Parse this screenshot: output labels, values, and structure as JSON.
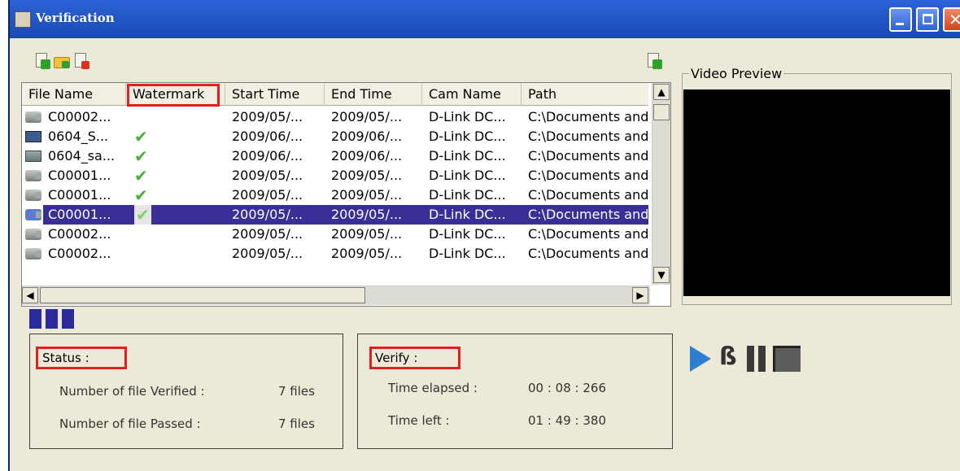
{
  "window": {
    "title": "Verification"
  },
  "list": {
    "columns": [
      "File Name",
      "Watermark",
      "Start Time",
      "End Time",
      "Cam Name",
      "Path"
    ],
    "rows": [
      {
        "name": "C00002...",
        "watermark": "",
        "start": "2009/05/...",
        "end": "2009/05/...",
        "cam": "D-Link DC...",
        "path": "C:\\Documents and",
        "icon": "camera-icon"
      },
      {
        "name": "0604_S...",
        "watermark": "✔",
        "start": "2009/06/...",
        "end": "2009/06/...",
        "cam": "D-Link DC...",
        "path": "C:\\Documents and",
        "icon": "film-icon"
      },
      {
        "name": "0604_sa...",
        "watermark": "✔",
        "start": "2009/06/...",
        "end": "2009/06/...",
        "cam": "D-Link DC...",
        "path": "C:\\Documents and",
        "icon": "image-icon"
      },
      {
        "name": "C00001...",
        "watermark": "✔",
        "start": "2009/05/...",
        "end": "2009/05/...",
        "cam": "D-Link DC...",
        "path": "C:\\Documents and",
        "icon": "camera-icon"
      },
      {
        "name": "C00001...",
        "watermark": "✔",
        "start": "2009/05/...",
        "end": "2009/05/...",
        "cam": "D-Link DC...",
        "path": "C:\\Documents and",
        "icon": "camera-icon"
      },
      {
        "name": "C00001...",
        "watermark": "✔",
        "start": "2009/05/...",
        "end": "2009/05/...",
        "cam": "D-Link DC...",
        "path": "C:\\Documents and",
        "icon": "camera-icon"
      },
      {
        "name": "C00002...",
        "watermark": "",
        "start": "2009/05/...",
        "end": "2009/05/...",
        "cam": "D-Link DC...",
        "path": "C:\\Documents and",
        "icon": "camera-icon"
      },
      {
        "name": "C00002...",
        "watermark": "",
        "start": "2009/05/...",
        "end": "2009/05/...",
        "cam": "D-Link DC...",
        "path": "C:\\Documents and",
        "icon": "camera-icon"
      }
    ],
    "selected_index": 5
  },
  "status": {
    "title": "Status :",
    "verified_label": "Number of file Verified :",
    "verified_value": "7  files",
    "passed_label": "Number of file Passed :",
    "passed_value": "7  files"
  },
  "verify": {
    "title": "Verify :",
    "elapsed_label": "Time elapsed :",
    "elapsed_value": "00 : 08 : 266",
    "left_label": "Time left :",
    "left_value": "01 : 49 : 380"
  },
  "preview": {
    "label": "Video Preview"
  },
  "colors": {
    "title_bar": "#2357c8",
    "selection": "#3a2f96",
    "highlight_box": "#e02020",
    "progress": "#2a2a9c",
    "play": "#2f7fd0"
  },
  "progress": {
    "filled_segments": 3
  }
}
